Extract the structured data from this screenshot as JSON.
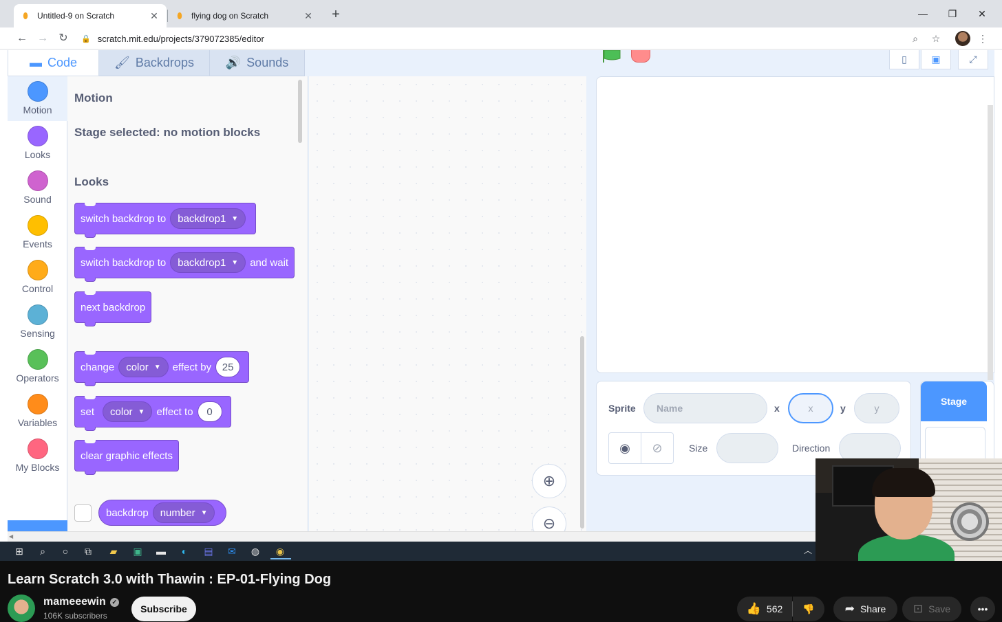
{
  "browser": {
    "tabs": [
      {
        "title": "Untitled-9 on Scratch",
        "active": true
      },
      {
        "title": "flying dog on Scratch",
        "active": false
      }
    ],
    "url": "scratch.mit.edu/projects/379072385/editor"
  },
  "scratch": {
    "editor_tabs": {
      "code": "Code",
      "backdrops": "Backdrops",
      "sounds": "Sounds"
    },
    "categories": [
      {
        "label": "Motion",
        "color": "#4c97ff"
      },
      {
        "label": "Looks",
        "color": "#9966ff"
      },
      {
        "label": "Sound",
        "color": "#cf63cf"
      },
      {
        "label": "Events",
        "color": "#ffbf00"
      },
      {
        "label": "Control",
        "color": "#ffab19"
      },
      {
        "label": "Sensing",
        "color": "#5cb1d6"
      },
      {
        "label": "Operators",
        "color": "#59c059"
      },
      {
        "label": "Variables",
        "color": "#ff8c1a"
      },
      {
        "label": "My Blocks",
        "color": "#ff6680"
      }
    ],
    "palette": {
      "motion_heading": "Motion",
      "motion_note": "Stage selected: no motion blocks",
      "looks_heading": "Looks",
      "blocks": {
        "b1": {
          "text": "switch backdrop to",
          "dropdown": "backdrop1"
        },
        "b2": {
          "text": "switch backdrop to",
          "dropdown": "backdrop1",
          "suffix": "and wait"
        },
        "b3": {
          "text": "next backdrop"
        },
        "b4": {
          "text": "change",
          "dropdown": "color",
          "middle": "effect by",
          "value": "25"
        },
        "b5": {
          "text": "set",
          "dropdown": "color",
          "middle": "effect to",
          "value": "0"
        },
        "b6": {
          "text": "clear graphic effects"
        },
        "b7": {
          "text": "backdrop",
          "dropdown": "number"
        }
      }
    },
    "sprite_info": {
      "sprite_label": "Sprite",
      "name_placeholder": "Name",
      "x_label": "x",
      "x_placeholder": "x",
      "y_label": "y",
      "y_placeholder": "y",
      "size_label": "Size",
      "direction_label": "Direction"
    },
    "stage_pane": {
      "header": "Stage"
    }
  },
  "youtube": {
    "title": "Learn Scratch 3.0 with Thawin : EP-01-Flying Dog",
    "channel": "mameeewin",
    "subscribers": "106K subscribers",
    "subscribe": "Subscribe",
    "likes": "562",
    "share": "Share",
    "save": "Save"
  }
}
